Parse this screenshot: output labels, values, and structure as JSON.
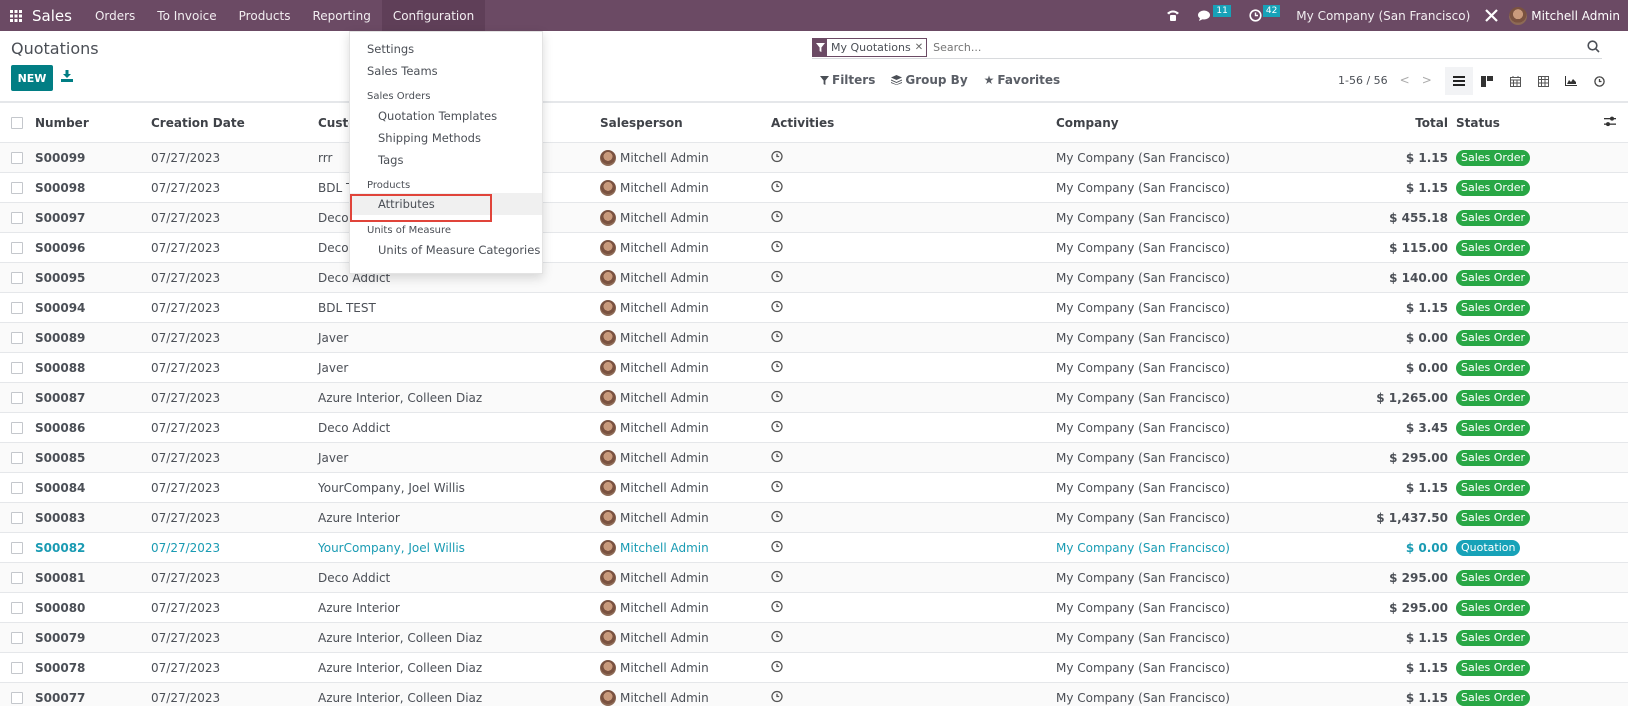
{
  "navbar": {
    "app_name": "Sales",
    "menu": [
      "Orders",
      "To Invoice",
      "Products",
      "Reporting",
      "Configuration"
    ],
    "open_menu": "Configuration",
    "messages_count": "11",
    "activities_count": "42",
    "company": "My Company (San Francisco)",
    "user": "Mitchell Admin"
  },
  "page": {
    "title": "Quotations",
    "new_label": "NEW"
  },
  "search": {
    "facet_label": "My Quotations",
    "placeholder": "Search..."
  },
  "filters": {
    "filters_label": "Filters",
    "groupby_label": "Group By",
    "favorites_label": "Favorites"
  },
  "pager": {
    "range": "1-56 / 56"
  },
  "views": [
    "list",
    "kanban",
    "calendar",
    "pivot",
    "graph",
    "activity"
  ],
  "active_view": "list",
  "config_menu": {
    "settings": "Settings",
    "sales_teams": "Sales Teams",
    "sales_orders_header": "Sales Orders",
    "quotation_templates": "Quotation Templates",
    "shipping_methods": "Shipping Methods",
    "tags": "Tags",
    "products_header": "Products",
    "attributes": "Attributes",
    "uom_header": "Units of Measure",
    "uom_categories": "Units of Measure Categories"
  },
  "table": {
    "headers": {
      "number": "Number",
      "creation_date": "Creation Date",
      "customer": "Customer",
      "salesperson": "Salesperson",
      "activities": "Activities",
      "company": "Company",
      "total": "Total",
      "status": "Status"
    },
    "rows": [
      {
        "number": "S00099",
        "date": "07/27/2023",
        "customer": "rrr",
        "salesperson": "Mitchell Admin",
        "company": "My Company (San Francisco)",
        "total": "$ 1.15",
        "status": "Sales Order"
      },
      {
        "number": "S00098",
        "date": "07/27/2023",
        "customer": "BDL TEST",
        "salesperson": "Mitchell Admin",
        "company": "My Company (San Francisco)",
        "total": "$ 1.15",
        "status": "Sales Order"
      },
      {
        "number": "S00097",
        "date": "07/27/2023",
        "customer": "Deco Addict",
        "salesperson": "Mitchell Admin",
        "company": "My Company (San Francisco)",
        "total": "$ 455.18",
        "status": "Sales Order"
      },
      {
        "number": "S00096",
        "date": "07/27/2023",
        "customer": "Deco Addict",
        "salesperson": "Mitchell Admin",
        "company": "My Company (San Francisco)",
        "total": "$ 115.00",
        "status": "Sales Order"
      },
      {
        "number": "S00095",
        "date": "07/27/2023",
        "customer": "Deco Addict",
        "salesperson": "Mitchell Admin",
        "company": "My Company (San Francisco)",
        "total": "$ 140.00",
        "status": "Sales Order"
      },
      {
        "number": "S00094",
        "date": "07/27/2023",
        "customer": "BDL TEST",
        "salesperson": "Mitchell Admin",
        "company": "My Company (San Francisco)",
        "total": "$ 1.15",
        "status": "Sales Order"
      },
      {
        "number": "S00089",
        "date": "07/27/2023",
        "customer": "Javer",
        "salesperson": "Mitchell Admin",
        "company": "My Company (San Francisco)",
        "total": "$ 0.00",
        "status": "Sales Order"
      },
      {
        "number": "S00088",
        "date": "07/27/2023",
        "customer": "Javer",
        "salesperson": "Mitchell Admin",
        "company": "My Company (San Francisco)",
        "total": "$ 0.00",
        "status": "Sales Order"
      },
      {
        "number": "S00087",
        "date": "07/27/2023",
        "customer": "Azure Interior, Colleen Diaz",
        "salesperson": "Mitchell Admin",
        "company": "My Company (San Francisco)",
        "total": "$ 1,265.00",
        "status": "Sales Order"
      },
      {
        "number": "S00086",
        "date": "07/27/2023",
        "customer": "Deco Addict",
        "salesperson": "Mitchell Admin",
        "company": "My Company (San Francisco)",
        "total": "$ 3.45",
        "status": "Sales Order"
      },
      {
        "number": "S00085",
        "date": "07/27/2023",
        "customer": "Javer",
        "salesperson": "Mitchell Admin",
        "company": "My Company (San Francisco)",
        "total": "$ 295.00",
        "status": "Sales Order"
      },
      {
        "number": "S00084",
        "date": "07/27/2023",
        "customer": "YourCompany, Joel Willis",
        "salesperson": "Mitchell Admin",
        "company": "My Company (San Francisco)",
        "total": "$ 1.15",
        "status": "Sales Order"
      },
      {
        "number": "S00083",
        "date": "07/27/2023",
        "customer": "Azure Interior",
        "salesperson": "Mitchell Admin",
        "company": "My Company (San Francisco)",
        "total": "$ 1,437.50",
        "status": "Sales Order"
      },
      {
        "number": "S00082",
        "date": "07/27/2023",
        "customer": "YourCompany, Joel Willis",
        "salesperson": "Mitchell Admin",
        "company": "My Company (San Francisco)",
        "total": "$ 0.00",
        "status": "Quotation"
      },
      {
        "number": "S00081",
        "date": "07/27/2023",
        "customer": "Deco Addict",
        "salesperson": "Mitchell Admin",
        "company": "My Company (San Francisco)",
        "total": "$ 295.00",
        "status": "Sales Order"
      },
      {
        "number": "S00080",
        "date": "07/27/2023",
        "customer": "Azure Interior",
        "salesperson": "Mitchell Admin",
        "company": "My Company (San Francisco)",
        "total": "$ 295.00",
        "status": "Sales Order"
      },
      {
        "number": "S00079",
        "date": "07/27/2023",
        "customer": "Azure Interior, Colleen Diaz",
        "salesperson": "Mitchell Admin",
        "company": "My Company (San Francisco)",
        "total": "$ 1.15",
        "status": "Sales Order"
      },
      {
        "number": "S00078",
        "date": "07/27/2023",
        "customer": "Azure Interior, Colleen Diaz",
        "salesperson": "Mitchell Admin",
        "company": "My Company (San Francisco)",
        "total": "$ 1.15",
        "status": "Sales Order"
      },
      {
        "number": "S00077",
        "date": "07/27/2023",
        "customer": "Azure Interior, Colleen Diaz",
        "salesperson": "Mitchell Admin",
        "company": "My Company (San Francisco)",
        "total": "$ 1.15",
        "status": "Sales Order"
      }
    ]
  },
  "colors": {
    "navbar": "#6b4a64",
    "primary": "#017e84",
    "sales_order": "#28a745",
    "quotation": "#17a2b8",
    "highlight_box": "#e0443a"
  }
}
